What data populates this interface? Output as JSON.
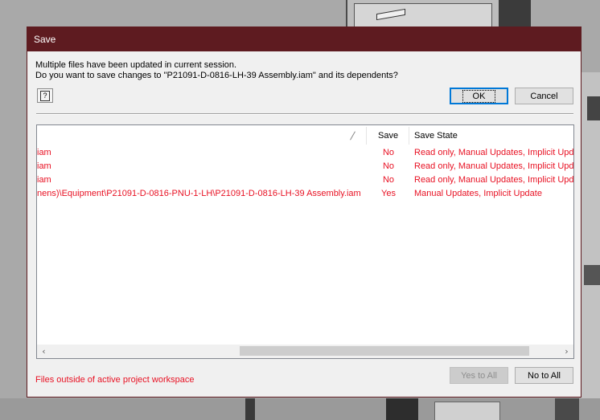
{
  "dialog": {
    "title": "Save",
    "message_line1": "Multiple files have been updated in current session.",
    "message_line2": "Do you want to save changes to \"P21091-D-0816-LH-39 Assembly.iam\" and its dependents?",
    "help_icon": "help-icon",
    "ok_label": "OK",
    "cancel_label": "Cancel"
  },
  "grid": {
    "columns": [
      "",
      "Save",
      "Save State"
    ],
    "rows": [
      {
        "path": "iam",
        "save": "No",
        "state": "Read only, Manual Updates, Implicit Update"
      },
      {
        "path": "iam",
        "save": "No",
        "state": "Read only, Manual Updates, Implicit Update"
      },
      {
        "path": "iam",
        "save": "No",
        "state": "Read only, Manual Updates, Implicit Update"
      },
      {
        "path": "nens)\\Equipment\\P21091-D-0816-PNU-1-LH\\P21091-D-0816-LH-39 Assembly.iam",
        "save": "Yes",
        "state": "Manual Updates, Implicit Update"
      }
    ],
    "scroll_left": "‹",
    "scroll_right": "›"
  },
  "footer": {
    "note": "Files outside of active project workspace",
    "yes_to_all_label": "Yes to All",
    "no_to_all_label": "No to All"
  },
  "colors": {
    "titlebar": "#5e1b20",
    "warning_text": "#e81123",
    "default_button_border": "#0078d7"
  }
}
